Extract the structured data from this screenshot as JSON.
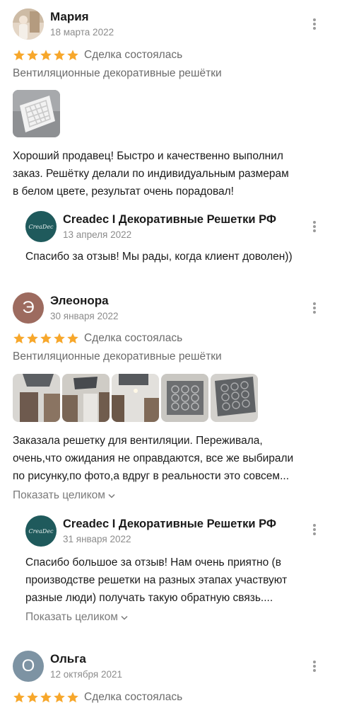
{
  "colors": {
    "star": "#f7a72b",
    "seller_avatar": "#1f5a5c",
    "avatar_eleonora": "#9d6b5f",
    "avatar_olga": "#7d93a3"
  },
  "reviews": [
    {
      "author": "Мария",
      "date": "18 марта 2022",
      "rating": 5,
      "deal": "Сделка состоялась",
      "category": "Вентиляционные декоративные решётки",
      "text_lines": [
        "Хороший продавец! Быстро и качественно выполнил",
        "заказ. Решётку делали по индивидуальным размерам",
        "в белом цвете, результат очень порадовал!"
      ],
      "reply": {
        "seller": "Creadec I Декоративные Решетки РФ",
        "seller_logo": "CreaDec",
        "date": "13 апреля 2022",
        "text_lines": [
          "Спасибо за отзыв! Мы рады, когда клиент доволен))"
        ]
      }
    },
    {
      "author": "Элеонора",
      "avatar_letter": "Э",
      "date": "30 января 2022",
      "rating": 5,
      "deal": "Сделка состоялась",
      "category": "Вентиляционные декоративные решётки",
      "text_lines": [
        "Заказала решетку для вентиляции. Переживала,",
        "очень,что ожидания не оправдаются, все же выбирали",
        "по рисунку,по фото,а вдруг в реальности это совсем..."
      ],
      "show_more": "Показать целиком",
      "reply": {
        "seller": "Creadec I Декоративные Решетки РФ",
        "seller_logo": "CreaDec",
        "date": "31 января 2022",
        "text_lines": [
          "Спасибо большое за отзыв! Нам очень приятно (в",
          "производстве решетки на разных этапах участвуют",
          "разные люди) получать такую обратную связь...."
        ],
        "show_more": "Показать целиком"
      }
    },
    {
      "author": "Ольга",
      "avatar_letter": "О",
      "date": "12 октября 2021",
      "rating": 5,
      "deal": "Сделка состоялась"
    }
  ]
}
